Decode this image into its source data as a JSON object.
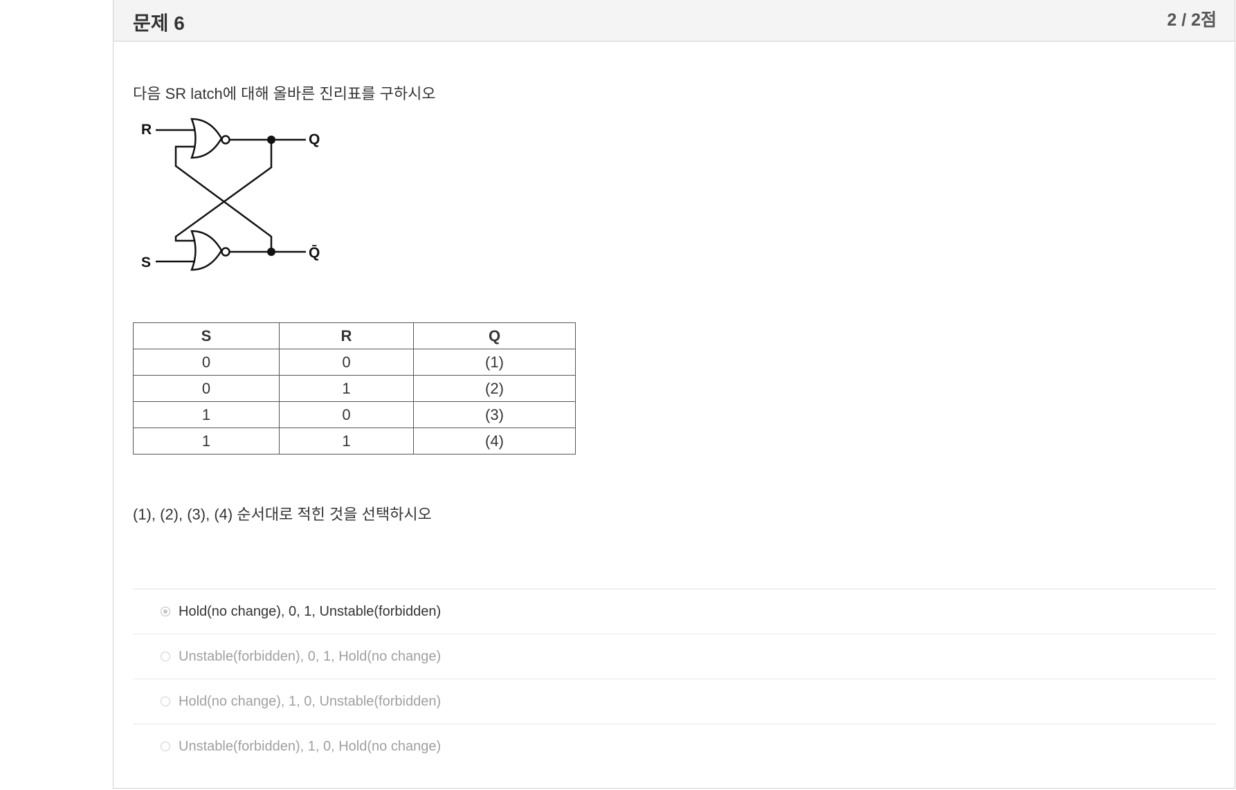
{
  "question": {
    "title": "문제 6",
    "score": "2 / 2점",
    "prompt": "다음 SR latch에 대해 올바른 진리표를 구하시오",
    "instruction": "(1), (2), (3), (4) 순서대로 적힌 것을 선택하시오"
  },
  "circuit": {
    "labels": {
      "r": "R",
      "s": "S",
      "q": "Q",
      "qbar": "Q̄"
    }
  },
  "truth_table": {
    "headers": [
      "S",
      "R",
      "Q"
    ],
    "rows": [
      [
        "0",
        "0",
        "(1)"
      ],
      [
        "0",
        "1",
        "(2)"
      ],
      [
        "1",
        "0",
        "(3)"
      ],
      [
        "1",
        "1",
        "(4)"
      ]
    ]
  },
  "options": [
    {
      "label": "Hold(no change), 0, 1, Unstable(forbidden)",
      "selected": true
    },
    {
      "label": "Unstable(forbidden), 0, 1, Hold(no change)",
      "selected": false
    },
    {
      "label": "Hold(no change), 1, 0, Unstable(forbidden)",
      "selected": false
    },
    {
      "label": "Unstable(forbidden), 1, 0, Hold(no change)",
      "selected": false
    }
  ]
}
